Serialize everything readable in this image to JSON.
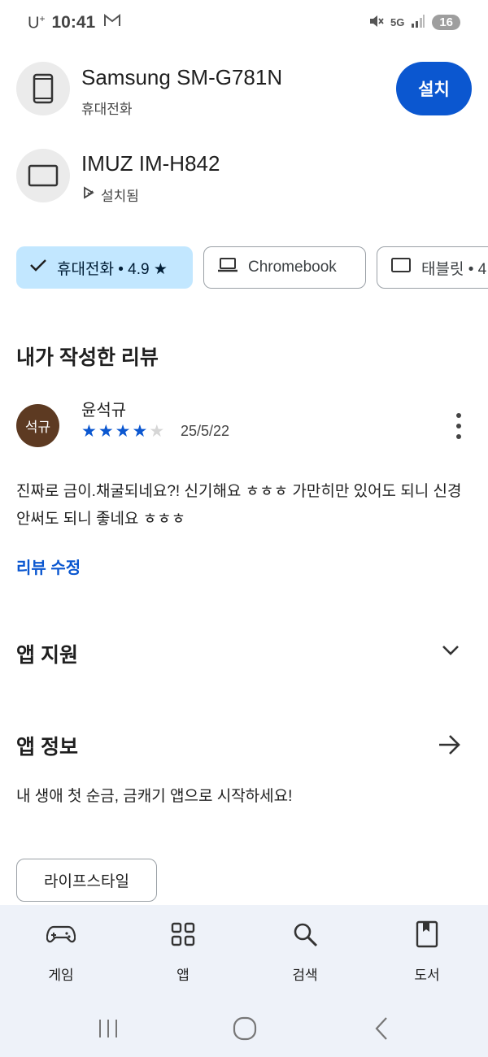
{
  "status_bar": {
    "carrier": "U",
    "carrier_sup": "+",
    "time": "10:41",
    "network": "5G",
    "battery": "16"
  },
  "devices": [
    {
      "name": "Samsung SM-G781N",
      "type": "휴대전화",
      "icon": "phone-icon"
    },
    {
      "name": "IMUZ IM-H842",
      "status": "설치됨",
      "icon": "tablet-icon"
    }
  ],
  "install_button": "설치",
  "chips": [
    {
      "label": "휴대전화 • 4.9 ★",
      "selected": true,
      "icon": "check-icon"
    },
    {
      "label": "Chromebook",
      "selected": false,
      "icon": "laptop-icon"
    },
    {
      "label": "태블릿 • 4",
      "selected": false,
      "icon": "tablet-icon"
    }
  ],
  "my_review": {
    "section_title": "내가 작성한 리뷰",
    "avatar_text": "석규",
    "reviewer": "윤석규",
    "rating": 4,
    "max_rating": 5,
    "date": "25/5/22",
    "text": "진짜로 금이.채굴되네요?! 신기해요 ㅎㅎㅎ 가만히만 있어도 되니 신경 안써도 되니 좋네요 ㅎㅎㅎ",
    "edit_link": "리뷰 수정"
  },
  "app_support": {
    "title": "앱 지원"
  },
  "app_info": {
    "title": "앱 정보",
    "description": "내 생애 첫 순금, 금캐기 앱으로 시작하세요!",
    "category": "라이프스타일"
  },
  "bottom_nav": [
    {
      "label": "게임",
      "icon": "gamepad-icon"
    },
    {
      "label": "앱",
      "icon": "apps-grid-icon"
    },
    {
      "label": "검색",
      "icon": "search-icon"
    },
    {
      "label": "도서",
      "icon": "book-icon"
    }
  ],
  "colors": {
    "accent": "#0b57d0",
    "chip_selected": "#c2e7ff",
    "nav_bg": "#eef2f9",
    "avatar": "#5d3a22"
  }
}
